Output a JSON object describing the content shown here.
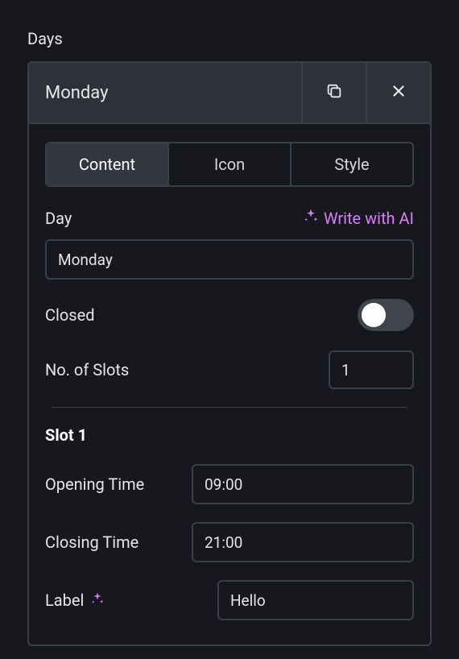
{
  "section_label": "Days",
  "day_header": {
    "title": "Monday"
  },
  "tabs": {
    "content": "Content",
    "icon": "Icon",
    "style": "Style"
  },
  "fields": {
    "day_label": "Day",
    "ai_link": "Write with AI",
    "day_value": "Monday",
    "closed_label": "Closed",
    "closed_value": false,
    "slots_label": "No. of Slots",
    "slots_value": "1"
  },
  "slot": {
    "title": "Slot 1",
    "opening_label": "Opening Time",
    "opening_value": "09:00",
    "closing_label": "Closing Time",
    "closing_value": "21:00",
    "label_label": "Label",
    "label_value": "Hello"
  }
}
